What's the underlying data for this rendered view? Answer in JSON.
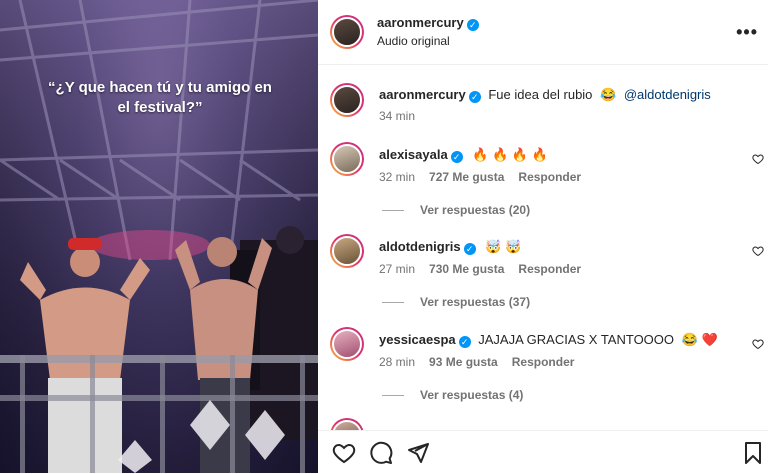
{
  "video": {
    "caption": "“¿Y que hacen tú y tu amigo en el festival?”"
  },
  "post": {
    "author": "aaronmercury",
    "audio": "Audio original",
    "caption_author": "aaronmercury",
    "caption_text": "Fue idea del rubio",
    "caption_emoji": "😂",
    "caption_mention": "@aldotdenigris",
    "caption_time": "34 min"
  },
  "comments": [
    {
      "user": "alexisayala",
      "text": "🔥 🔥 🔥 🔥",
      "time": "32 min",
      "likes": "727 Me gusta",
      "reply": "Responder",
      "view_replies": "Ver respuestas (20)"
    },
    {
      "user": "aldotdenigris",
      "text": "🤯 🤯",
      "time": "27 min",
      "likes": "730 Me gusta",
      "reply": "Responder",
      "view_replies": "Ver respuestas (37)"
    },
    {
      "user": "yessicaespa",
      "text": "JAJAJA GRACIAS X TANTOOOO",
      "emojis": "😂 ❤️",
      "time": "28 min",
      "likes": "93 Me gusta",
      "reply": "Responder",
      "view_replies": "Ver respuestas (4)"
    }
  ],
  "colors": {
    "link": "#00376b",
    "verified": "#0095f6",
    "muted": "#737373",
    "text": "#262626"
  },
  "icons": [
    "heart-icon",
    "comment-icon",
    "share-icon",
    "bookmark-icon",
    "more-icon",
    "verified-badge-icon"
  ]
}
